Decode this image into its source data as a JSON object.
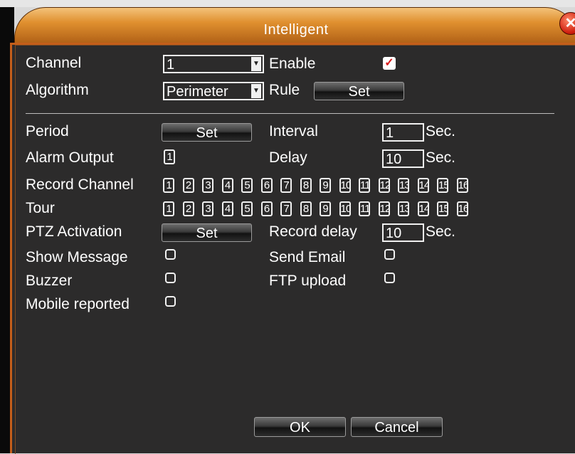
{
  "dialog": {
    "title": "Intelligent",
    "close_symbol": "✕"
  },
  "channel": {
    "label": "Channel",
    "value": "1"
  },
  "enable": {
    "label": "Enable",
    "checked": true,
    "check_glyph": "✓"
  },
  "algorithm": {
    "label": "Algorithm",
    "value": "Perimeter"
  },
  "rule": {
    "label": "Rule",
    "button": "Set"
  },
  "period": {
    "label": "Period",
    "button": "Set"
  },
  "interval": {
    "label": "Interval",
    "value": "1",
    "unit": "Sec."
  },
  "alarm_output": {
    "label": "Alarm Output",
    "value": "1"
  },
  "delay": {
    "label": "Delay",
    "value": "10",
    "unit": "Sec."
  },
  "record_channel": {
    "label": "Record Channel",
    "channels": [
      "1",
      "2",
      "3",
      "4",
      "5",
      "6",
      "7",
      "8",
      "9",
      "10",
      "11",
      "12",
      "13",
      "14",
      "15",
      "16"
    ]
  },
  "tour": {
    "label": "Tour",
    "channels": [
      "1",
      "2",
      "3",
      "4",
      "5",
      "6",
      "7",
      "8",
      "9",
      "10",
      "11",
      "12",
      "13",
      "14",
      "15",
      "16"
    ]
  },
  "ptz_activation": {
    "label": "PTZ Activation",
    "button": "Set"
  },
  "record_delay": {
    "label": "Record delay",
    "value": "10",
    "unit": "Sec."
  },
  "show_message": {
    "label": "Show Message",
    "checked": false
  },
  "send_email": {
    "label": "Send Email",
    "checked": false
  },
  "buzzer": {
    "label": "Buzzer",
    "checked": false
  },
  "ftp_upload": {
    "label": "FTP upload",
    "checked": false
  },
  "mobile_reported": {
    "label": "Mobile reported",
    "checked": false
  },
  "footer": {
    "ok": "OK",
    "cancel": "Cancel"
  },
  "colors": {
    "accent": "#c45e1a",
    "panel": "#2c2b2b",
    "check_mark": "#d81b1b"
  }
}
